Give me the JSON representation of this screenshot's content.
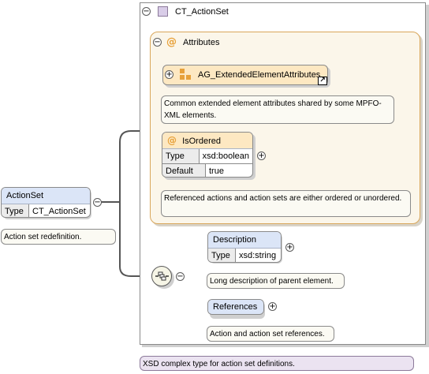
{
  "complex_type": {
    "name": "CT_ActionSet",
    "description": "XSD complex type for action set definitions."
  },
  "attributes_group": {
    "label": "Attributes",
    "extended_attributes": {
      "name": "AG_ExtendedElementAttributes",
      "description": "Common extended element attributes shared by some MPFO-XML elements."
    },
    "is_ordered": {
      "name": "IsOrdered",
      "type_key": "Type",
      "type_value": "xsd:boolean",
      "default_key": "Default",
      "default_value": "true",
      "description": "Referenced actions and action sets are either ordered or unordered."
    }
  },
  "action_set": {
    "name": "ActionSet",
    "type_key": "Type",
    "type_value": "CT_ActionSet",
    "description": "Action set redefinition."
  },
  "sequence": {
    "description_element": {
      "name": "Description",
      "type_key": "Type",
      "type_value": "xsd:string",
      "note": "Long description of parent element."
    },
    "references_element": {
      "name": "References",
      "note": "Action and action set references."
    }
  },
  "icons": [
    "collapse-icon",
    "expand-icon",
    "attribute-at-icon",
    "complex-type-icon",
    "attribute-group-icon",
    "shortcut-arrow-icon",
    "sequence-compositor-icon"
  ],
  "colors": {
    "element_header": "#dbe5f7",
    "attribute_header": "#fde8c2",
    "attribute_accent": "#e7a13a",
    "complex_type_swatch": "#d9cde8",
    "note_background": "#fbfaf3",
    "type_note_background": "#ebe3f1"
  }
}
